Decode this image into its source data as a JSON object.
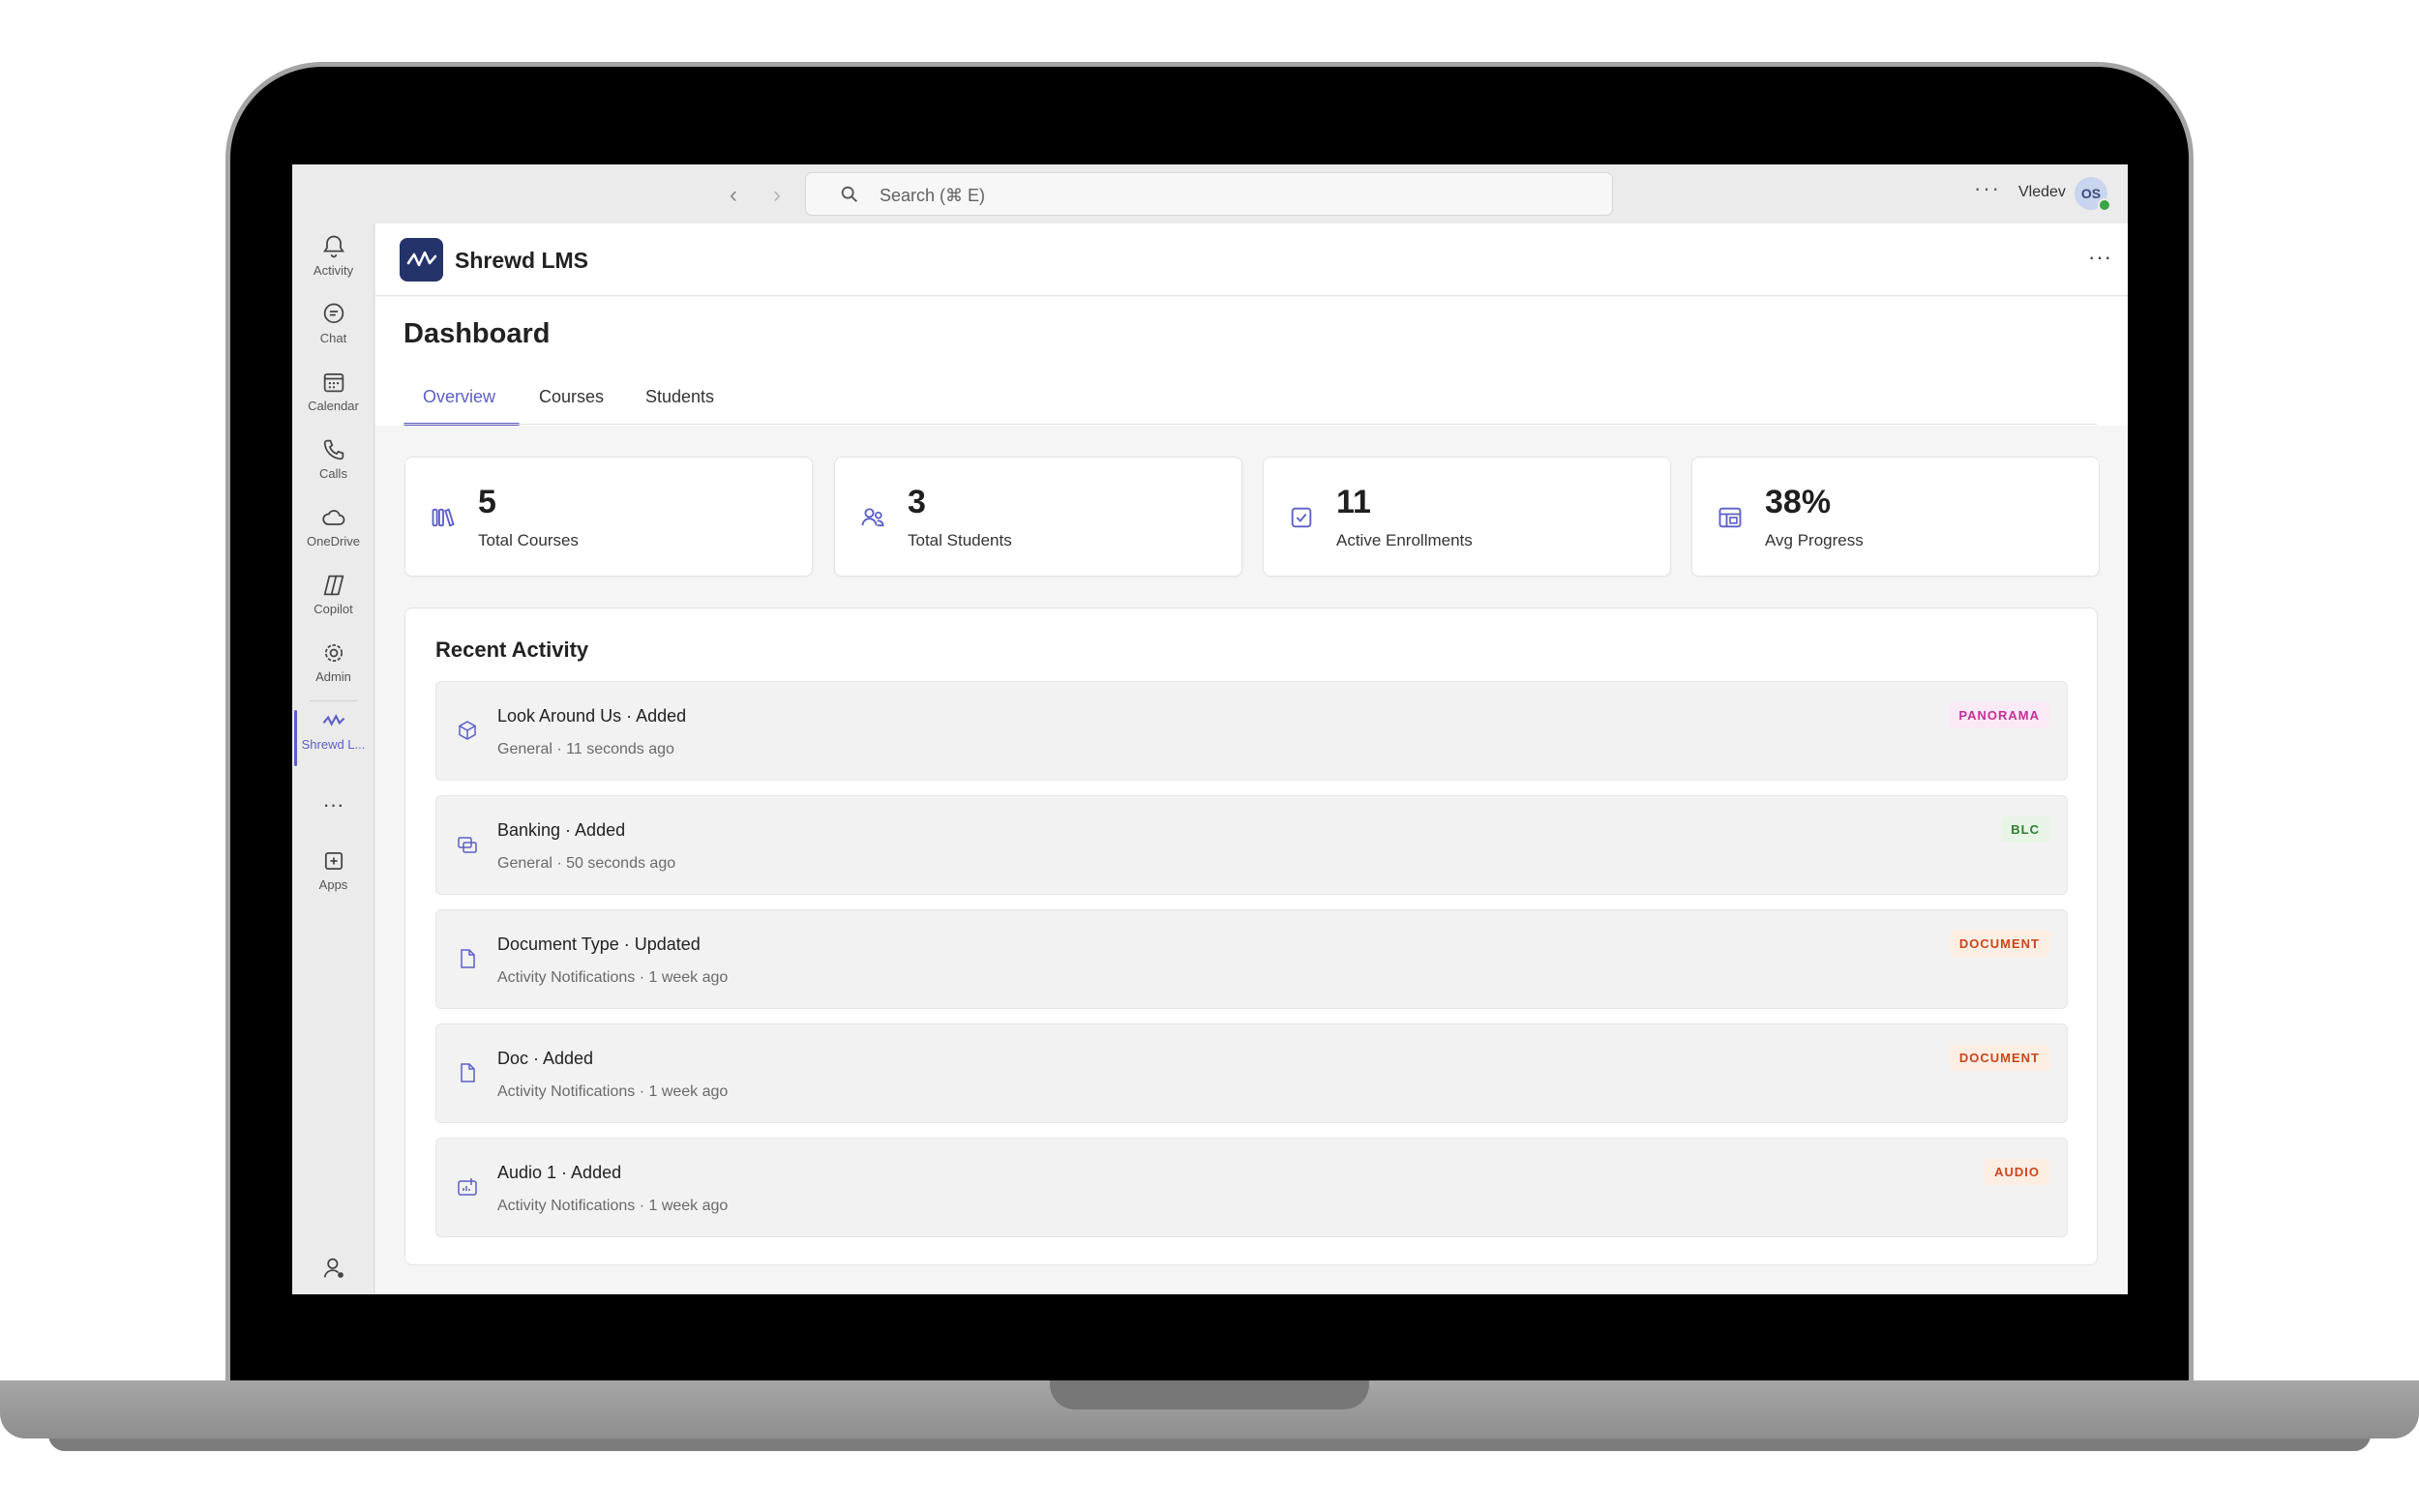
{
  "titlebar": {
    "search_placeholder": "Search (⌘ E)",
    "more_label": "···",
    "user_name": "Vledev",
    "avatar_initials": "OS",
    "status_color": "#3aa543"
  },
  "rail": {
    "items": [
      {
        "label": "Activity",
        "icon": "bell-icon"
      },
      {
        "label": "Chat",
        "icon": "chat-icon"
      },
      {
        "label": "Calendar",
        "icon": "calendar-icon"
      },
      {
        "label": "Calls",
        "icon": "phone-icon"
      },
      {
        "label": "OneDrive",
        "icon": "cloud-icon"
      },
      {
        "label": "Copilot",
        "icon": "copilot-icon"
      },
      {
        "label": "Admin",
        "icon": "admin-icon"
      },
      {
        "label": "Shrewd L...",
        "icon": "shrewd-wave-icon",
        "active": true
      },
      {
        "label": "",
        "icon": "more-icon"
      },
      {
        "label": "Apps",
        "icon": "add-app-icon"
      }
    ],
    "more_label": "···"
  },
  "app": {
    "title": "Shrewd LMS",
    "more_label": "···",
    "brand_color": "#24346b",
    "accent_color": "#5b5fc7"
  },
  "page": {
    "title": "Dashboard",
    "tabs": [
      {
        "label": "Overview",
        "active": true
      },
      {
        "label": "Courses"
      },
      {
        "label": "Students"
      }
    ]
  },
  "stats": [
    {
      "value": "5",
      "label": "Total Courses",
      "icon": "books-icon"
    },
    {
      "value": "3",
      "label": "Total Students",
      "icon": "users-icon"
    },
    {
      "value": "11",
      "label": "Active Enrollments",
      "icon": "checkbox-icon"
    },
    {
      "value": "38%",
      "label": "Avg Progress",
      "icon": "progress-grid-icon"
    }
  ],
  "activity": {
    "title": "Recent Activity",
    "items": [
      {
        "title": "Look Around Us · Added",
        "sub": "General · 11 seconds ago",
        "badge": "PANORAMA",
        "badge_color": "#c2309a",
        "badge_bg": "#fbeaf5",
        "icon": "cube-icon"
      },
      {
        "title": "Banking · Added",
        "sub": "General · 50 seconds ago",
        "badge": "BLC",
        "badge_color": "#2f7d32",
        "badge_bg": "#e8f5e6",
        "icon": "layers-icon"
      },
      {
        "title": "Document Type · Updated",
        "sub": "Activity Notifications · 1 week ago",
        "badge": "DOCUMENT",
        "badge_color": "#c8461b",
        "badge_bg": "#fdeee4",
        "icon": "document-icon"
      },
      {
        "title": "Doc · Added",
        "sub": "Activity Notifications · 1 week ago",
        "badge": "DOCUMENT",
        "badge_color": "#c8461b",
        "badge_bg": "#fdeee4",
        "icon": "document-icon"
      },
      {
        "title": "Audio 1 · Added",
        "sub": "Activity Notifications · 1 week ago",
        "badge": "AUDIO",
        "badge_color": "#c8461b",
        "badge_bg": "#fdeee4",
        "icon": "audio-icon"
      }
    ]
  }
}
